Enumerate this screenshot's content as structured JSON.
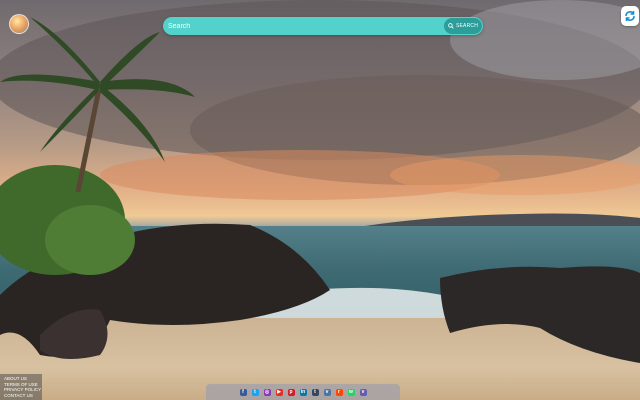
{
  "search": {
    "placeholder": "Search",
    "button_label": "SEARCH"
  },
  "footer_links": [
    "ABOUT US",
    "TERMS OF USE",
    "PRIVACY POLICY",
    "CONTACT US"
  ],
  "social_icons": [
    {
      "name": "facebook-icon",
      "glyph": "f",
      "color": "#3b5998"
    },
    {
      "name": "twitter-icon",
      "glyph": "t",
      "color": "#1da1f2"
    },
    {
      "name": "instagram-icon",
      "glyph": "◎",
      "color": "#8a3ab9"
    },
    {
      "name": "youtube-icon",
      "glyph": "▶",
      "color": "#e52d27"
    },
    {
      "name": "pinterest-icon",
      "glyph": "p",
      "color": "#cb2027"
    },
    {
      "name": "linkedin-icon",
      "glyph": "in",
      "color": "#0e76a8"
    },
    {
      "name": "tumblr-icon",
      "glyph": "t",
      "color": "#36465d"
    },
    {
      "name": "vk-icon",
      "glyph": "v",
      "color": "#4c75a3"
    },
    {
      "name": "reddit-icon",
      "glyph": "r",
      "color": "#ff4500"
    },
    {
      "name": "whatsapp-icon",
      "glyph": "w",
      "color": "#25d366"
    },
    {
      "name": "viber-icon",
      "glyph": "v",
      "color": "#665cac"
    }
  ],
  "colors": {
    "search_bar": "#53d2cc",
    "search_button": "#2c9d99"
  }
}
